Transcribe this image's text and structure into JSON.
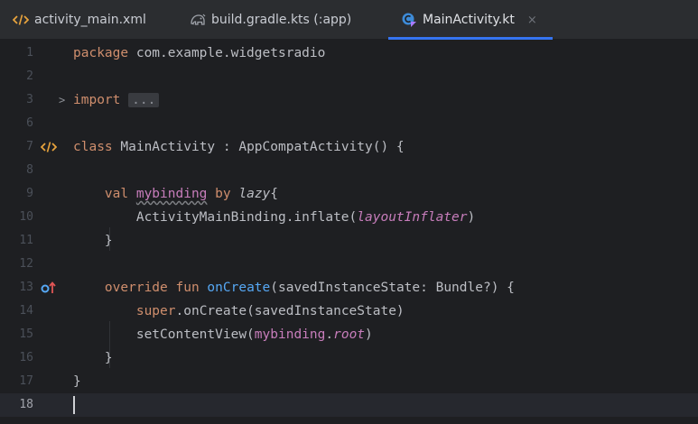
{
  "tabs": [
    {
      "label": "activity_main.xml",
      "icon": "xml-code-icon",
      "active": false
    },
    {
      "label": "build.gradle.kts (:app)",
      "icon": "gradle-elephant-icon",
      "active": false
    },
    {
      "label": "MainActivity.kt",
      "icon": "kotlin-class-icon",
      "active": true,
      "close": "×"
    }
  ],
  "lines": [
    {
      "num": "1",
      "tokens": [
        {
          "t": "package ",
          "c": "kw"
        },
        {
          "t": "com.example.widgetsradio",
          "c": ""
        }
      ]
    },
    {
      "num": "2",
      "tokens": []
    },
    {
      "num": "3",
      "fold": ">",
      "tokens": [
        {
          "t": "import ",
          "c": "kw"
        },
        {
          "t": "...",
          "c": "folded"
        }
      ]
    },
    {
      "num": "6",
      "tokens": []
    },
    {
      "num": "7",
      "gutter": "xml-layout-icon",
      "tokens": [
        {
          "t": "class ",
          "c": "kw"
        },
        {
          "t": "MainActivity : AppCompatActivity() {",
          "c": ""
        }
      ]
    },
    {
      "num": "8",
      "tokens": []
    },
    {
      "num": "9",
      "tokens": [
        {
          "t": "    ",
          "c": ""
        },
        {
          "t": "val ",
          "c": "kw"
        },
        {
          "t": "mybinding",
          "c": "prop under"
        },
        {
          "t": " ",
          "c": ""
        },
        {
          "t": "by ",
          "c": "kw"
        },
        {
          "t": "lazy",
          "c": "ital"
        },
        {
          "t": "{",
          "c": ""
        }
      ]
    },
    {
      "num": "10",
      "tokens": [
        {
          "t": "        ActivityMainBinding.inflate(",
          "c": ""
        },
        {
          "t": "layoutInflater",
          "c": "prop ital"
        },
        {
          "t": ")",
          "c": ""
        }
      ]
    },
    {
      "num": "11",
      "tokens": [
        {
          "t": "    }",
          "c": ""
        }
      ]
    },
    {
      "num": "12",
      "tokens": []
    },
    {
      "num": "13",
      "gutter": "override-icon",
      "tokens": [
        {
          "t": "    ",
          "c": ""
        },
        {
          "t": "override fun ",
          "c": "kw"
        },
        {
          "t": "onCreate",
          "c": "fn"
        },
        {
          "t": "(savedInstanceState: Bundle?) {",
          "c": ""
        }
      ]
    },
    {
      "num": "14",
      "tokens": [
        {
          "t": "        ",
          "c": ""
        },
        {
          "t": "super",
          "c": "kw"
        },
        {
          "t": ".onCreate(savedInstanceState)",
          "c": ""
        }
      ]
    },
    {
      "num": "15",
      "tokens": [
        {
          "t": "        setContentView(",
          "c": ""
        },
        {
          "t": "mybinding",
          "c": "prop"
        },
        {
          "t": ".",
          "c": ""
        },
        {
          "t": "root",
          "c": "prop ital"
        },
        {
          "t": ")",
          "c": ""
        }
      ]
    },
    {
      "num": "16",
      "tokens": [
        {
          "t": "    }",
          "c": ""
        }
      ]
    },
    {
      "num": "17",
      "tokens": [
        {
          "t": "}",
          "c": ""
        }
      ]
    },
    {
      "num": "18",
      "current": true,
      "caret": true,
      "tokens": []
    }
  ],
  "colors": {
    "background": "#1e1f22",
    "tabbar": "#2b2d30",
    "active_tab_underline": "#3574f0",
    "keyword": "#cf8e6d",
    "function": "#56a8f5",
    "property": "#c77dbb",
    "text": "#bcbec4"
  }
}
